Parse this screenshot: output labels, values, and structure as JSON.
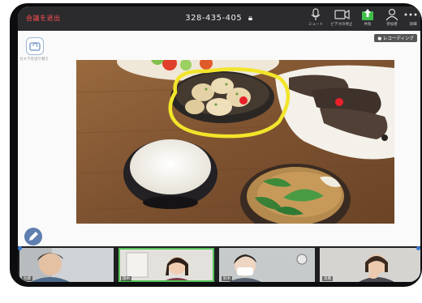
{
  "toolbar": {
    "exit_label": "会議を退出",
    "meeting_id": "328-435-405",
    "mute_label": "ミュート",
    "video_label": "ビデオの停止",
    "share_label": "共有",
    "participants_label": "参加者",
    "more_label": "詳細"
  },
  "recording_label": "レコーディング",
  "switch_camera_label": "カメラを切り替え",
  "participants": [
    {
      "name": "佐藤"
    },
    {
      "name": "田中"
    },
    {
      "name": "鈴木"
    },
    {
      "name": "高橋"
    }
  ],
  "colors": {
    "annotation_yellow": "#f2e52b",
    "annotation_dot": "#e8202a",
    "active_speaker": "#56c35a",
    "toolbar_bg": "#2b2b2e"
  }
}
